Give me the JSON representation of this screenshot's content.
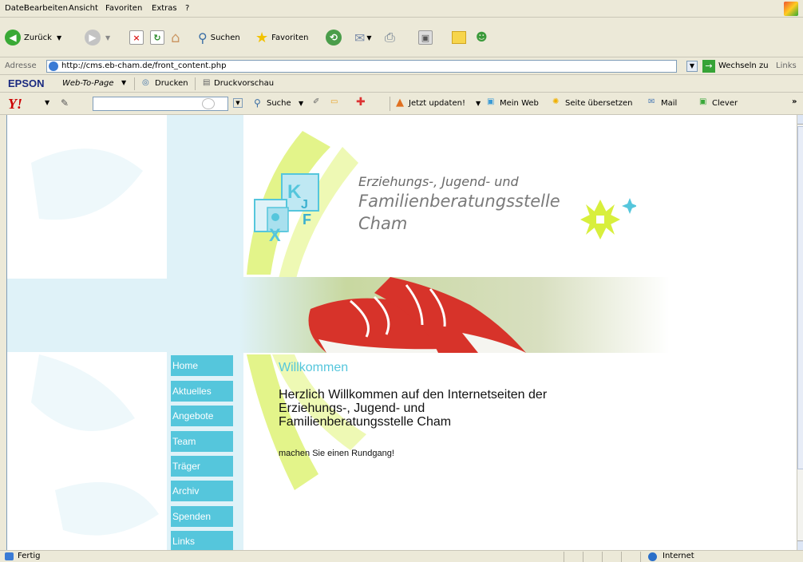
{
  "menu": [
    "Datei",
    "Bearbeiten",
    "Ansicht",
    "Favoriten",
    "Extras",
    "?"
  ],
  "toolbar": {
    "back": "Zurück",
    "search": "Suchen",
    "favorites": "Favoriten"
  },
  "address": {
    "label": "Adresse",
    "url": "http://cms.eb-cham.de/front_content.php",
    "go": "Wechseln zu",
    "links": "Links"
  },
  "epson": {
    "brand": "EPSON",
    "web_to_page": "Web-To-Page",
    "print": "Drucken",
    "preview": "Druckvorschau"
  },
  "yahoo": {
    "search": "Suche",
    "update": "Jetzt updaten!",
    "my_web": "Mein Web",
    "translate": "Seite übersetzen",
    "mail": "Mail",
    "clever": "Clever",
    "more": "»"
  },
  "site": {
    "title_lines": [
      "Erziehungs-, Jugend- und",
      "Familienberatungsstelle",
      "Cham"
    ],
    "nav": [
      "Home",
      "Aktuelles",
      "Angebote",
      "Team",
      "Träger",
      "Archiv",
      "Spenden",
      "Links"
    ],
    "heading": "Willkommen",
    "intro_lines": [
      "Herzlich Willkommen auf den Internetseiten der",
      "Erziehungs-, Jugend- und",
      "Familienberatungsstelle Cham"
    ],
    "sub": "machen Sie einen Rundgang!"
  },
  "status": {
    "text": "Fertig",
    "zone": "Internet"
  },
  "colors": {
    "accent": "#55c6dc",
    "lime": "#d8ef3c",
    "sneaker_red": "#d7332a"
  }
}
